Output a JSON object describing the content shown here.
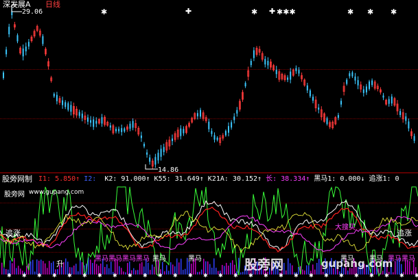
{
  "header": {
    "title": "深发展A",
    "period": "日线",
    "high_label": "29.06",
    "low_label": "14.86"
  },
  "indicator_bar": {
    "name": "股旁网制",
    "items": [
      {
        "key": "I1:",
        "value": "5.850",
        "arrow": "↑",
        "color": "#ff3030"
      },
      {
        "key": "I2:",
        "value": "",
        "arrow": "",
        "color": "#4060ff"
      },
      {
        "key": "K2:",
        "value": "91.000",
        "arrow": "↑",
        "color": "#ffffff"
      },
      {
        "key": "K55:",
        "value": "31.649",
        "arrow": "↑",
        "color": "#ffffff"
      },
      {
        "key": "K21A:",
        "value": "30.152",
        "arrow": "↑",
        "color": "#ffffff"
      },
      {
        "key": "长:",
        "value": "38.334",
        "arrow": "↑",
        "color": "#ff40ff"
      },
      {
        "key": "黑马1:",
        "value": "0.000",
        "arrow": "↓",
        "color": "#ffffff"
      },
      {
        "key": "追涨1:",
        "value": "0",
        "arrow": "",
        "color": "#ffffff"
      }
    ]
  },
  "watermark": {
    "site_cn": "股旁网",
    "site_url": "www.gupang.com",
    "big_cn": "股旁网",
    "big_url": "gupang.com"
  },
  "lower_labels": {
    "zhuizhang": "追涨",
    "heima": "黑马",
    "dabuy": "大搜买",
    "sheng": "升"
  },
  "colors": {
    "up": "#ff3b3b",
    "down": "#3cc8ff",
    "green": "#39ff39",
    "magenta": "#ff40ff",
    "white": "#ffffff",
    "yellow": "#ffff40",
    "red_line": "#ff2020"
  }
}
